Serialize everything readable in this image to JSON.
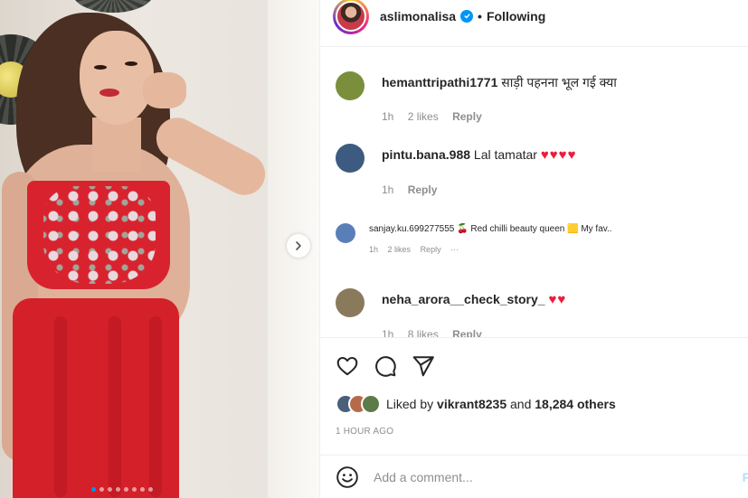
{
  "header": {
    "username": "aslimonalisa",
    "separator": "•",
    "follow_status": "Following"
  },
  "photo": {
    "carousel_count": 8,
    "carousel_active": 0
  },
  "comments": [
    {
      "username": "hemanttripathi1771",
      "text": "साड़ी पहनना भूल गई क्या",
      "time": "1h",
      "likes": "2 likes",
      "reply": "Reply",
      "avatar_color": "#7a8f3b"
    },
    {
      "username": "pintu.bana.988",
      "text": "Lal tamatar",
      "hearts": "♥♥♥♥",
      "time": "1h",
      "reply": "Reply",
      "avatar_color": "#3d5a80"
    },
    {
      "username": "sanjay.ku.699277555",
      "text": "🍒 Red chilli beauty queen 🟨 My fav..",
      "time": "1h",
      "likes": "2 likes",
      "reply": "Reply",
      "more": "···",
      "avatar_color": "#5a7fb8"
    },
    {
      "username": "neha_arora__check_story_",
      "hearts": "♥♥",
      "time": "1h",
      "likes": "8 likes",
      "reply": "Reply",
      "avatar_color": "#8a7a5c"
    }
  ],
  "likes": {
    "prefix": "Liked by",
    "user": "vikrant8235",
    "middle": "and",
    "others": "18,284 others",
    "liker_colors": [
      "#4a5f7a",
      "#b56a4a",
      "#5d7a4a"
    ]
  },
  "timestamp": "1 HOUR AGO",
  "comment_box": {
    "placeholder": "Add a comment...",
    "post_label": "P"
  }
}
